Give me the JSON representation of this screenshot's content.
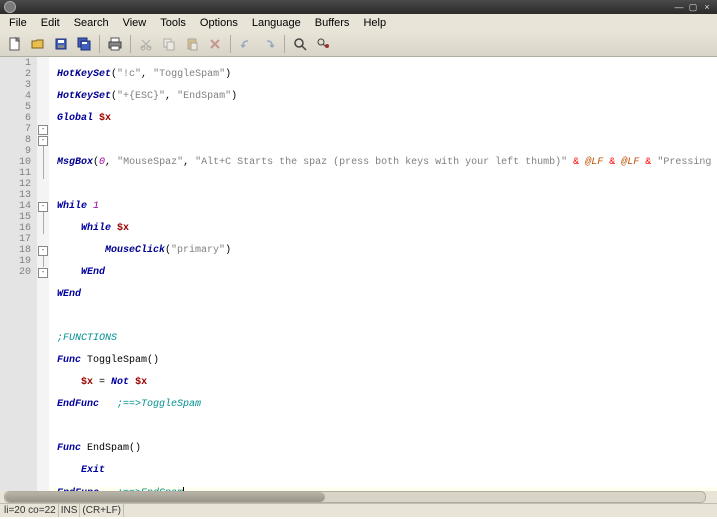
{
  "menus": {
    "file": "File",
    "edit": "Edit",
    "search": "Search",
    "view": "View",
    "tools": "Tools",
    "options": "Options",
    "language": "Language",
    "buffers": "Buffers",
    "help": "Help"
  },
  "code": {
    "l1": {
      "fn": "HotKeySet",
      "s1": "\"!c\"",
      "s2": "\"ToggleSpam\""
    },
    "l2": {
      "fn": "HotKeySet",
      "s1": "\"+{ESC}\"",
      "s2": "\"EndSpam\""
    },
    "l3": {
      "kw": "Global",
      "var": "$x"
    },
    "l5": {
      "fn": "MsgBox",
      "n": "0",
      "s1": "\"MouseSpaz\"",
      "s2": "\"Alt+C Starts the spaz (press both keys with your left thumb)\"",
      "m1": "@LF",
      "m2": "@LF",
      "s3": "\"Pressing Alt+C again will stop the"
    },
    "l7": {
      "kw": "While",
      "n": "1"
    },
    "l8": {
      "kw": "While",
      "var": "$x"
    },
    "l9": {
      "fn": "MouseClick",
      "s": "\"primary\""
    },
    "l10": {
      "kw": "WEnd"
    },
    "l11": {
      "kw": "WEnd"
    },
    "l13": {
      "c": ";FUNCTIONS"
    },
    "l14": {
      "kw": "Func",
      "name": "ToggleSpam"
    },
    "l15": {
      "var": "$x",
      "kw": "Not",
      "var2": "$x"
    },
    "l16": {
      "kw": "EndFunc",
      "c": ";==>ToggleSpam"
    },
    "l18": {
      "kw": "Func",
      "name": "EndSpam"
    },
    "l19": {
      "kw": "Exit"
    },
    "l20": {
      "kw": "EndFunc",
      "c": ";==>EndSpam"
    }
  },
  "line_numbers": [
    "1",
    "2",
    "3",
    "4",
    "5",
    "6",
    "7",
    "8",
    "9",
    "10",
    "11",
    "12",
    "13",
    "14",
    "15",
    "16",
    "17",
    "18",
    "19",
    "20"
  ],
  "status": {
    "pos": "li=20 co=22",
    "ins": "INS",
    "eol": "(CR+LF)"
  }
}
